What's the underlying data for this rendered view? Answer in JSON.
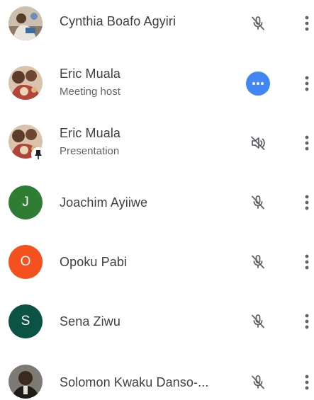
{
  "colors": {
    "host_accent": "#4285f4",
    "icon_gray": "#5f6368",
    "text_primary": "#3c4043",
    "text_secondary": "#5f6368"
  },
  "participants": [
    {
      "name": "Cynthia Boafo Agyiri",
      "subtitle": "",
      "avatar": {
        "type": "photo",
        "icon": "person-photo-avatar"
      },
      "status_icon": "mic-off-icon",
      "menu_icon": "more-vert-icon"
    },
    {
      "name": "Eric Muala",
      "subtitle": "Meeting host",
      "avatar": {
        "type": "photo",
        "icon": "person-photo-avatar"
      },
      "status_icon": "more-horiz-circle-icon",
      "menu_icon": "more-vert-icon"
    },
    {
      "name": "Eric Muala",
      "subtitle": "Presentation",
      "avatar": {
        "type": "photo",
        "icon": "person-photo-avatar",
        "badge": "pin-icon"
      },
      "status_icon": "volume-off-icon",
      "menu_icon": "more-vert-icon"
    },
    {
      "name": "Joachim Ayiiwe",
      "subtitle": "",
      "avatar": {
        "type": "letter",
        "letter": "J",
        "color": "#2e7d32"
      },
      "status_icon": "mic-off-icon",
      "menu_icon": "more-vert-icon"
    },
    {
      "name": "Opoku Pabi",
      "subtitle": "",
      "avatar": {
        "type": "letter",
        "letter": "O",
        "color": "#f4511e"
      },
      "status_icon": "mic-off-icon",
      "menu_icon": "more-vert-icon"
    },
    {
      "name": "Sena Ziwu",
      "subtitle": "",
      "avatar": {
        "type": "letter",
        "letter": "S",
        "color": "#0b5345"
      },
      "status_icon": "mic-off-icon",
      "menu_icon": "more-vert-icon"
    },
    {
      "name": "Solomon Kwaku Danso-...",
      "subtitle": "",
      "avatar": {
        "type": "photo",
        "icon": "person-photo-avatar"
      },
      "status_icon": "mic-off-icon",
      "menu_icon": "more-vert-icon"
    }
  ]
}
